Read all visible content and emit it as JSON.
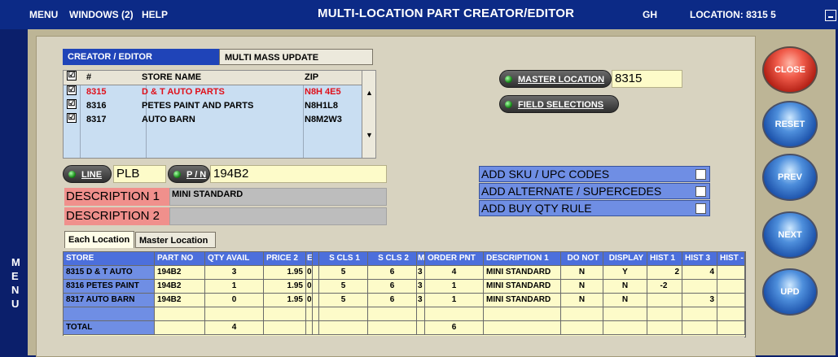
{
  "menubar": {
    "menu": "MENU",
    "windows": "WINDOWS (2)",
    "help": "HELP",
    "title": "MULTI-LOCATION PART CREATOR/EDITOR",
    "user": "GH",
    "location": "LOCATION:  8315   5"
  },
  "sidebar": {
    "letters": [
      "M",
      "E",
      "N",
      "U"
    ]
  },
  "tabs": {
    "creator": "CREATOR / EDITOR",
    "mass": "MULTI MASS UPDATE"
  },
  "store_list": {
    "headers": {
      "check": "☑",
      "num": "#",
      "name": "STORE NAME",
      "zip": "ZIP"
    },
    "rows": [
      {
        "num": "8315",
        "name": "D & T AUTO PARTS",
        "zip": "N8H 4E5",
        "checked": "☑"
      },
      {
        "num": "8316",
        "name": "PETES PAINT AND PARTS",
        "zip": "N8H1L8",
        "checked": "☑"
      },
      {
        "num": "8317",
        "name": "AUTO BARN",
        "zip": "N8M2W3",
        "checked": "☑"
      }
    ]
  },
  "master": {
    "label": "MASTER LOCATION",
    "value": "8315",
    "field_selections": "FIELD SELECTIONS"
  },
  "part": {
    "line_label": "LINE",
    "line_value": "PLB",
    "pn_label": "P / N",
    "pn_value": "194B2"
  },
  "description": {
    "label1": "DESCRIPTION 1",
    "value1": "MINI STANDARD",
    "label2": "DESCRIPTION 2",
    "value2": ""
  },
  "add_options": [
    {
      "label": "ADD SKU / UPC CODES"
    },
    {
      "label": "ADD ALTERNATE / SUPERCEDES"
    },
    {
      "label": "ADD BUY QTY RULE"
    }
  ],
  "buttons": {
    "close": "CLOSE",
    "reset": "RESET",
    "prev": "PREV",
    "next": "NEXT",
    "upd": "UPD"
  },
  "grid_tabs": {
    "each": "Each Location",
    "master": "Master Location"
  },
  "grid": {
    "headers": [
      "STORE",
      "PART NO",
      "QTY AVAIL",
      "PRICE 2",
      "E",
      "",
      "S CLS 1",
      "S CLS 2",
      "M",
      "ORDER PNT",
      "DESCRIPTION 1",
      "DO NOT",
      "DISPLAY",
      "HIST 1",
      "HIST 3",
      "HIST -"
    ],
    "rows": [
      {
        "store": "8315 D & T AUTO",
        "part": "194B2",
        "qty": "3",
        "price": "1.95",
        "e": "0",
        "s1": "5",
        "s2": "6",
        "m": "3",
        "op": "4",
        "desc": "MINI STANDARD",
        "donot": "N",
        "display": "Y",
        "h1": "2",
        "h3": "4"
      },
      {
        "store": "8316 PETES PAINT",
        "part": "194B2",
        "qty": "1",
        "price": "1.95",
        "e": "0",
        "s1": "5",
        "s2": "6",
        "m": "3",
        "op": "1",
        "desc": "MINI STANDARD",
        "donot": "N",
        "display": "N",
        "h1": "-2",
        "h3": ""
      },
      {
        "store": "8317 AUTO BARN",
        "part": "194B2",
        "qty": "0",
        "price": "1.95",
        "e": "0",
        "s1": "5",
        "s2": "6",
        "m": "3",
        "op": "1",
        "desc": "MINI STANDARD",
        "donot": "N",
        "display": "N",
        "h1": "",
        "h3": "3"
      }
    ],
    "total": {
      "label": "TOTAL",
      "qty": "4",
      "op": "6"
    }
  },
  "colors": {
    "accent_blue": "#1f44b8",
    "selected_red": "#e0101a",
    "desc_pink": "#f0908c",
    "yellow_field": "#fdfbc9"
  }
}
